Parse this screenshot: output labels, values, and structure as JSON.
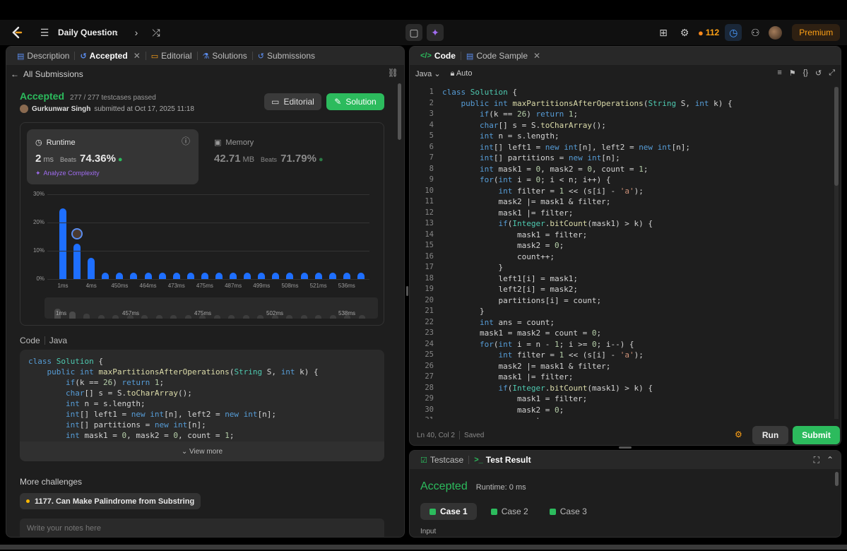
{
  "topbar": {
    "title": "Daily Question",
    "streak": "112",
    "premium": "Premium"
  },
  "left": {
    "tabs": [
      "Description",
      "Accepted",
      "Editorial",
      "Solutions",
      "Submissions"
    ],
    "back": "All Submissions",
    "status": "Accepted",
    "passed": "277 / 277 testcases passed",
    "user": "Gurkunwar Singh",
    "submitted": "submitted at Oct 17, 2025 11:18",
    "editorial_btn": "Editorial",
    "solution_btn": "Solution",
    "runtime_label": "Runtime",
    "runtime_val": "2",
    "runtime_unit": "ms",
    "beats": "Beats",
    "runtime_pct": "74.36%",
    "analyze": "Analyze Complexity",
    "memory_label": "Memory",
    "memory_val": "42.71",
    "memory_unit": "MB",
    "memory_pct": "71.79%",
    "code_label": "Code",
    "lang": "Java",
    "view_more": "View more",
    "more": "More challenges",
    "challenge": "1177. Can Make Palindrome from Substring",
    "notes_ph": "Write your notes here"
  },
  "chart_data": {
    "type": "bar",
    "ylabel_ticks": [
      "30%",
      "20%",
      "10%",
      "0%"
    ],
    "ylim": [
      0,
      30
    ],
    "values": [
      25,
      12.5,
      7.5,
      2.2,
      2.2,
      2.2,
      2.2,
      2.2,
      2.2,
      2.2,
      2.2,
      2.2,
      2.2,
      2.2,
      2.2,
      2.2,
      2.2,
      2.2,
      2.2,
      2.2,
      2.2,
      2.2
    ],
    "x_ticks": [
      "1ms",
      "4ms",
      "450ms",
      "464ms",
      "473ms",
      "475ms",
      "487ms",
      "499ms",
      "508ms",
      "521ms",
      "536ms"
    ],
    "mini_ticks": [
      "1ms",
      "457ms",
      "475ms",
      "502ms",
      "538ms"
    ],
    "highlight_index": 1
  },
  "right": {
    "tabs": [
      "Code",
      "Code Sample"
    ],
    "lang": "Java",
    "auto": "Auto",
    "status": "Ln 40, Col 2",
    "saved": "Saved",
    "run": "Run",
    "submit": "Submit"
  },
  "code_lines": [
    "class Solution {",
    "    public int maxPartitionsAfterOperations(String S, int k) {",
    "        if(k == 26) return 1;",
    "        char[] s = S.toCharArray();",
    "        int n = s.length;",
    "        int[] left1 = new int[n], left2 = new int[n];",
    "        int[] partitions = new int[n];",
    "        int mask1 = 0, mask2 = 0, count = 1;",
    "        for(int i = 0; i < n; i++) {",
    "            int filter = 1 << (s[i] - 'a');",
    "            mask2 |= mask1 & filter;",
    "            mask1 |= filter;",
    "            if(Integer.bitCount(mask1) > k) {",
    "                mask1 = filter;",
    "                mask2 = 0;",
    "                count++;",
    "            }",
    "            left1[i] = mask1;",
    "            left2[i] = mask2;",
    "            partitions[i] = count;",
    "        }",
    "        int ans = count;",
    "        mask1 = mask2 = count = 0;",
    "        for(int i = n - 1; i >= 0; i--) {",
    "            int filter = 1 << (s[i] - 'a');",
    "            mask2 |= mask1 & filter;",
    "            mask1 |= filter;",
    "            if(Integer.bitCount(mask1) > k) {",
    "                mask1 = filter;",
    "                mask2 = 0;",
    "                count++;"
  ],
  "preview_lines": [
    "class Solution {",
    "    public int maxPartitionsAfterOperations(String S, int k) {",
    "        if(k == 26) return 1;",
    "        char[] s = S.toCharArray();",
    "        int n = s.length;",
    "        int[] left1 = new int[n], left2 = new int[n];",
    "        int[] partitions = new int[n];",
    "        int mask1 = 0, mask2 = 0, count = 1;"
  ],
  "bottom": {
    "tabs": [
      "Testcase",
      "Test Result"
    ],
    "status": "Accepted",
    "runtime": "Runtime: 0 ms",
    "cases": [
      "Case 1",
      "Case 2",
      "Case 3"
    ],
    "input": "Input"
  }
}
